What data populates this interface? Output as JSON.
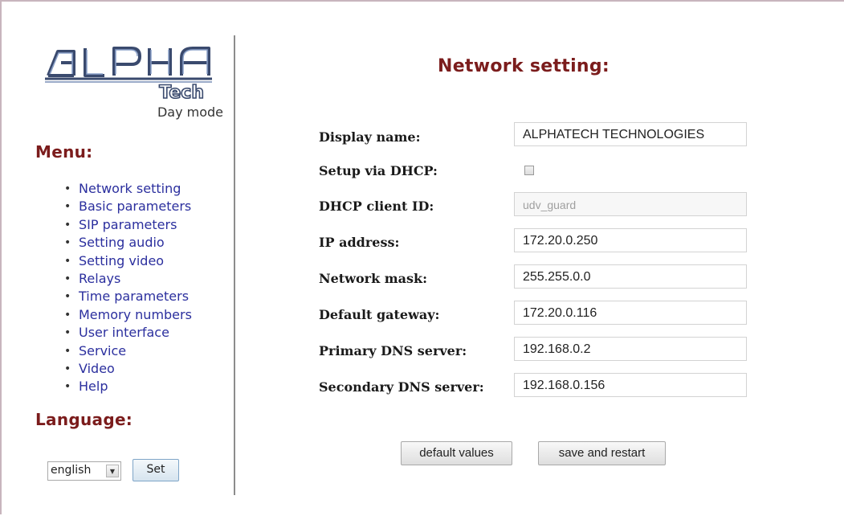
{
  "sidebar": {
    "mode_label": "Day mode",
    "menu_heading": "Menu:",
    "menu_items": [
      {
        "label": "Network setting"
      },
      {
        "label": "Basic parameters"
      },
      {
        "label": "SIP parameters"
      },
      {
        "label": "Setting audio"
      },
      {
        "label": "Setting video"
      },
      {
        "label": "Relays"
      },
      {
        "label": "Time parameters"
      },
      {
        "label": "Memory numbers"
      },
      {
        "label": "User interface"
      },
      {
        "label": "Service"
      },
      {
        "label": "Video"
      },
      {
        "label": "Help"
      }
    ],
    "language_heading": "Language:",
    "language_selected": "english",
    "set_label": "Set"
  },
  "logo": {
    "text_main": "ALPHA",
    "text_sub": "Tech"
  },
  "main": {
    "title": "Network setting:",
    "fields": {
      "display_name": {
        "label": "Display name:",
        "value": "ALPHATECH TECHNOLOGIES"
      },
      "dhcp": {
        "label": "Setup via DHCP:",
        "checked": false
      },
      "dhcp_client_id": {
        "label": "DHCP client ID:",
        "value": "udv_guard"
      },
      "ip_address": {
        "label": "IP address:",
        "value": "172.20.0.250"
      },
      "network_mask": {
        "label": "Network mask:",
        "value": "255.255.0.0"
      },
      "default_gateway": {
        "label": "Default gateway:",
        "value": "172.20.0.116"
      },
      "primary_dns": {
        "label": "Primary DNS server:",
        "value": "192.168.0.2"
      },
      "secondary_dns": {
        "label": "Secondary DNS server:",
        "value": "192.168.0.156"
      }
    },
    "buttons": {
      "default_values": "default values",
      "save_and_restart": "save and restart"
    }
  },
  "colors": {
    "heading": "#7b1c1c",
    "link": "#2b2f9e"
  }
}
